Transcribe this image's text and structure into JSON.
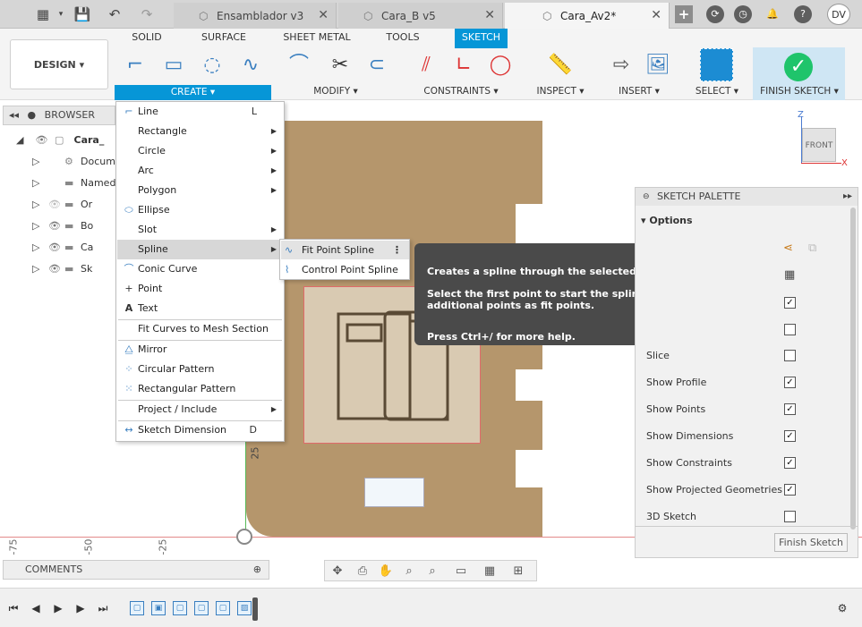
{
  "tabs": [
    {
      "label": "Ensamblador v3",
      "active": false
    },
    {
      "label": "Cara_B v5",
      "active": false
    },
    {
      "label": "Cara_Av2*",
      "active": true
    }
  ],
  "user_initials": "DV",
  "ribbon": {
    "design_label": "DESIGN",
    "tabs": [
      "SOLID",
      "SURFACE",
      "SHEET METAL",
      "TOOLS",
      "SKETCH"
    ],
    "active_tab": "SKETCH",
    "groups": {
      "create": "CREATE",
      "modify": "MODIFY",
      "constraints": "CONSTRAINTS",
      "inspect": "INSPECT",
      "insert": "INSERT",
      "select": "SELECT",
      "finish_sketch": "FINISH SKETCH"
    }
  },
  "browser": {
    "title": "BROWSER",
    "root": "Cara_",
    "items": [
      "Docume",
      "Named V",
      "Or",
      "Bo",
      "Ca",
      "Sk"
    ]
  },
  "create_menu": {
    "items": [
      {
        "label": "Line",
        "shortcut": "L",
        "icon": "line-icon"
      },
      {
        "label": "Rectangle",
        "submenu": true
      },
      {
        "label": "Circle",
        "submenu": true
      },
      {
        "label": "Arc",
        "submenu": true
      },
      {
        "label": "Polygon",
        "submenu": true
      },
      {
        "label": "Ellipse",
        "icon": "ellipse-icon"
      },
      {
        "label": "Slot",
        "submenu": true
      },
      {
        "label": "Spline",
        "submenu": true,
        "highlighted": true
      },
      {
        "label": "Conic Curve",
        "icon": "conic-curve-icon"
      },
      {
        "label": "Point",
        "icon": "point-icon"
      },
      {
        "label": "Text",
        "icon": "text-icon"
      },
      {
        "label": "Fit Curves to Mesh Section"
      },
      {
        "label": "Mirror",
        "icon": "mirror-icon"
      },
      {
        "label": "Circular Pattern",
        "icon": "circular-pattern-icon"
      },
      {
        "label": "Rectangular Pattern",
        "icon": "rectangular-pattern-icon"
      },
      {
        "label": "Project / Include",
        "submenu": true
      },
      {
        "label": "Sketch Dimension",
        "shortcut": "D",
        "icon": "sketch-dimension-icon"
      }
    ]
  },
  "spline_submenu": {
    "items": [
      "Fit Point Spline",
      "Control Point Spline"
    ]
  },
  "tooltip": {
    "line1": "Creates a spline through the selected fit points.",
    "line2": "Select the first point to start the spline. Select additional points as fit points.",
    "line3": "Press Ctrl+/ for more help."
  },
  "sketch_palette": {
    "title": "SKETCH PALETTE",
    "section": "Options",
    "options": [
      {
        "label": "Slice",
        "checked": false
      },
      {
        "label": "Show Profile",
        "checked": true
      },
      {
        "label": "Show Points",
        "checked": true
      },
      {
        "label": "Show Dimensions",
        "checked": true
      },
      {
        "label": "Show Constraints",
        "checked": true
      },
      {
        "label": "Show Projected Geometries",
        "checked": true
      },
      {
        "label": "3D Sketch",
        "checked": false
      }
    ],
    "finish_button": "Finish Sketch"
  },
  "comments_label": "COMMENTS",
  "view_cube_label": "FRONT",
  "axis_labels": {
    "z": "Z",
    "x": "X"
  },
  "ruler": [
    "-75",
    "-50",
    "-25"
  ],
  "dimension_label": "25"
}
